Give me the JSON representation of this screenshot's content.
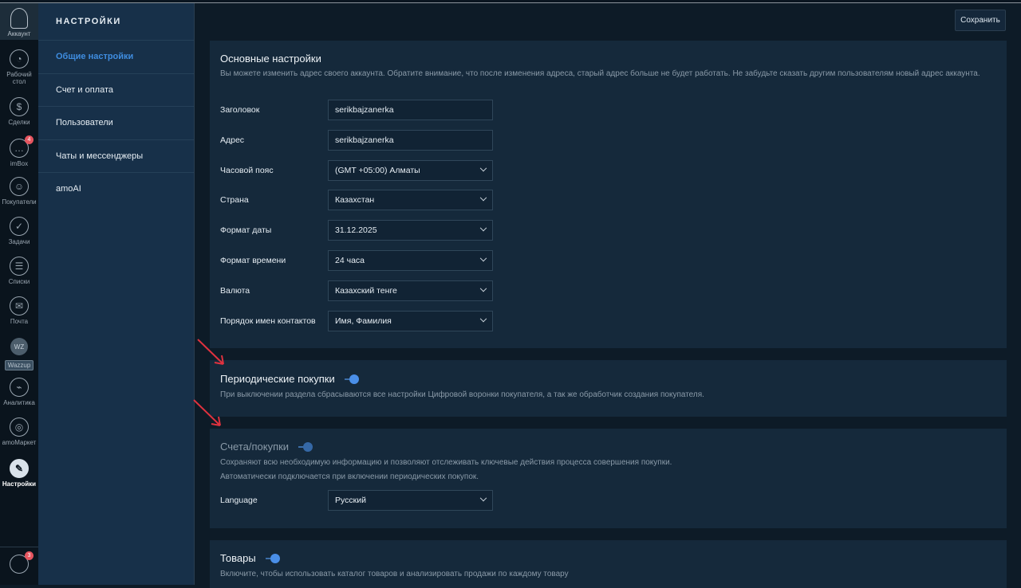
{
  "rail": {
    "account": "Аккаунт",
    "items": [
      {
        "label": "Рабочий стол",
        "icon": "dashboard-icon"
      },
      {
        "label": "Сделки",
        "icon": "dollar-icon"
      },
      {
        "label": "imBox",
        "icon": "chat-icon",
        "badge": "4"
      },
      {
        "label": "Покупатели",
        "icon": "customers-icon"
      },
      {
        "label": "Задачи",
        "icon": "check-icon"
      },
      {
        "label": "Списки",
        "icon": "list-icon"
      },
      {
        "label": "Почта",
        "icon": "mail-icon"
      },
      {
        "label": "Аналитика",
        "icon": "analytics-icon"
      },
      {
        "label": "amoМаркет",
        "icon": "market-icon"
      },
      {
        "label": "Настройки",
        "icon": "wrench-icon"
      }
    ],
    "wazzup": {
      "logo": "WZ",
      "label": "Wazzup"
    },
    "notifications_badge": "3"
  },
  "nav": {
    "title": "НАСТРОЙКИ",
    "items": [
      "Общие настройки",
      "Счет и оплата",
      "Пользователи",
      "Чаты и мессенджеры",
      "amoAI"
    ]
  },
  "save_label": "Сохранить",
  "basic": {
    "title": "Основные настройки",
    "description": "Вы можете изменить адрес своего аккаунта. Обратите внимание, что после изменения адреса, старый адрес больше не будет работать. Не забудьте сказать другим пользователям новый адрес аккаунта.",
    "fields": [
      {
        "label": "Заголовок",
        "value": "serikbajzanerka",
        "type": "input"
      },
      {
        "label": "Адрес",
        "value": "serikbajzanerka",
        "type": "input"
      },
      {
        "label": "Часовой пояс",
        "value": "(GMT +05:00) Алматы",
        "type": "select"
      },
      {
        "label": "Страна",
        "value": "Казахстан",
        "type": "select"
      },
      {
        "label": "Формат даты",
        "value": "31.12.2025",
        "type": "select"
      },
      {
        "label": "Формат времени",
        "value": "24 часа",
        "type": "select"
      },
      {
        "label": "Валюта",
        "value": "Казахский тенге",
        "type": "select"
      },
      {
        "label": "Порядок имен контактов",
        "value": "Имя, Фамилия",
        "type": "select"
      }
    ]
  },
  "periodic": {
    "title": "Периодические покупки",
    "enabled": true,
    "description": "При выключении раздела сбрасываются все настройки Цифровой воронки покупателя, а так же обработчик создания покупателя."
  },
  "invoices": {
    "title": "Счета/покупки",
    "enabled": true,
    "disabled_state": true,
    "description1": "Сохраняют всю необходимую информацию и позволяют отслеживать ключевые действия процесса совершения покупки.",
    "description2": "Автоматически подключается при включении периодических покупок.",
    "language_label": "Language",
    "language_value": "Русский"
  },
  "products": {
    "title": "Товары",
    "enabled": true,
    "description": "Включите, чтобы использовать каталог товаров и анализировать продажи по каждому товару"
  },
  "colors": {
    "accent": "#3f8de0",
    "toggle": "#4a8fe8",
    "arrow": "#e0323f",
    "badge": "#e6555f"
  }
}
